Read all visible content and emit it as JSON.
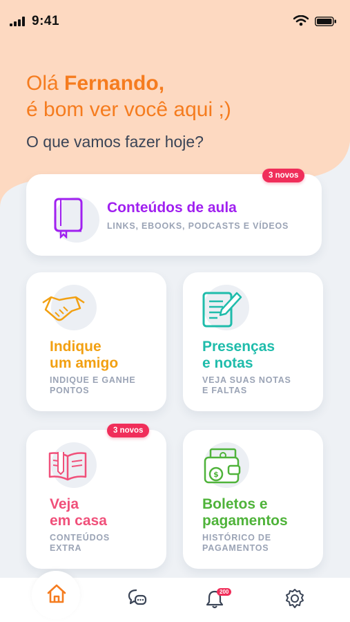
{
  "status": {
    "time": "9:41"
  },
  "greeting": {
    "hello": "Olá",
    "name": "Fernando,",
    "line2": "é bom ver você aqui ;)",
    "question": "O que vamos fazer hoje?"
  },
  "cards": {
    "conteudos": {
      "title": "Conteúdos de aula",
      "subtitle": "LINKS, EBOOKS, PODCASTS E VÍDEOS",
      "badge": "3 novos",
      "color": "#a020f0"
    },
    "indique": {
      "title_line1": "Indique",
      "title_line2": "um amigo",
      "sub_line1": "INDIQUE E GANHE",
      "sub_line2": "PONTOS",
      "color": "#f2a012"
    },
    "presencas": {
      "title_line1": "Presenças",
      "title_line2": "e notas",
      "sub_line1": "VEJA SUAS NOTAS",
      "sub_line2": "E FALTAS",
      "color": "#1fbcab"
    },
    "veja": {
      "title_line1": "Veja",
      "title_line2": "em casa",
      "sub_line1": "CONTEÚDOS",
      "sub_line2": "EXTRA",
      "badge": "3 novos",
      "color": "#f0507a"
    },
    "boletos": {
      "title_line1": "Boletos e",
      "title_line2": "pagamentos",
      "sub_line1": "HISTÓRICO DE",
      "sub_line2": "PAGAMENTOS",
      "color": "#4fb33a"
    }
  },
  "tabbar": {
    "items": [
      "home-icon",
      "chat-icon",
      "bell-icon",
      "gear-icon"
    ],
    "notifications": "200"
  }
}
